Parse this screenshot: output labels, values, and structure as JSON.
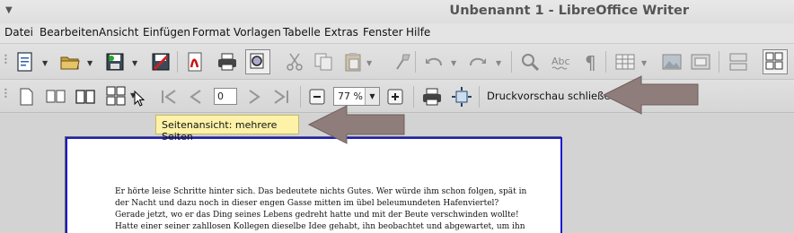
{
  "window": {
    "title": "Unbenannt 1 - LibreOffice Writer"
  },
  "menu": [
    "Datei",
    "Bearbeiten",
    "Ansicht",
    "Einfügen",
    "Format",
    "Vorlagen",
    "Tabelle",
    "Extras",
    "Fenster",
    "Hilfe"
  ],
  "standard_toolbar": {
    "icons": [
      "new-document",
      "open-folder",
      "save",
      "export-pdf",
      "pdf",
      "print",
      "print-preview",
      "cut",
      "copy",
      "paste",
      "clone-formatting",
      "undo",
      "redo",
      "find-replace",
      "spellcheck",
      "formatting-marks",
      "table",
      "image",
      "chart",
      "field",
      "navigator"
    ]
  },
  "preview_toolbar": {
    "page_number": "0",
    "zoom_value": "77 %",
    "close_preview_label": "Druckvorschau schließen"
  },
  "tooltip": {
    "text": "Seitenansicht: mehrere Seiten"
  },
  "document": {
    "lines": [
      "Er hörte leise Schritte hinter sich. Das bedeutete nichts Gutes. Wer würde ihm schon folgen, spät in",
      "der Nacht und dazu noch in dieser engen Gasse mitten im übel beleumundeten Hafenviertel?",
      "Gerade jetzt, wo er das Ding seines Lebens gedreht hatte und mit der Beute verschwinden wollte!",
      "Hatte einer seiner zahllosen Kollegen dieselbe Idee gehabt, ihn beobachtet und abgewartet, um ihn"
    ]
  },
  "colors": {
    "annotation_arrow": "#8e7d7a",
    "page_border": "#1a1ad0",
    "tooltip_bg": "#fdf2a8"
  }
}
